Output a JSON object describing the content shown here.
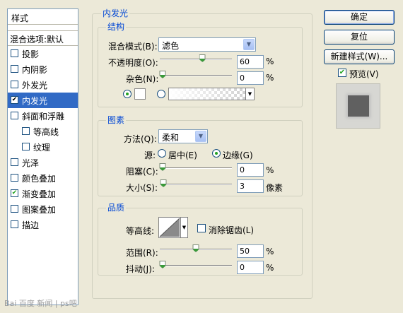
{
  "left_panel": {
    "header": "样式",
    "default_item": "混合选项:默认",
    "items": [
      {
        "label": "投影",
        "checked": false,
        "indent": false
      },
      {
        "label": "内阴影",
        "checked": false,
        "indent": false
      },
      {
        "label": "外发光",
        "checked": false,
        "indent": false
      },
      {
        "label": "内发光",
        "checked": true,
        "indent": false,
        "selected": true
      },
      {
        "label": "斜面和浮雕",
        "checked": false,
        "indent": false
      },
      {
        "label": "等高线",
        "checked": false,
        "indent": true
      },
      {
        "label": "纹理",
        "checked": false,
        "indent": true
      },
      {
        "label": "光泽",
        "checked": false,
        "indent": false
      },
      {
        "label": "颜色叠加",
        "checked": false,
        "indent": false
      },
      {
        "label": "渐变叠加",
        "checked": true,
        "indent": false
      },
      {
        "label": "图案叠加",
        "checked": false,
        "indent": false
      },
      {
        "label": "描边",
        "checked": false,
        "indent": false
      }
    ]
  },
  "panel_title": "内发光",
  "structure": {
    "title": "结构",
    "blend_mode_label": "混合模式(B):",
    "blend_mode_value": "滤色",
    "opacity_label": "不透明度(O):",
    "opacity_value": "60",
    "opacity_fraction": 0.6,
    "noise_label": "杂色(N):",
    "noise_value": "0",
    "noise_fraction": 0,
    "percent": "%"
  },
  "elements": {
    "title": "图素",
    "technique_label": "方法(Q):",
    "technique_value": "柔和",
    "source_label": "源:",
    "source_center": "居中(E)",
    "source_edge": "边缘(G)",
    "choke_label": "阻塞(C):",
    "choke_value": "0",
    "choke_fraction": 0,
    "size_label": "大小(S):",
    "size_value": "3",
    "size_fraction": 0.012,
    "percent": "%",
    "pixels": "像素"
  },
  "quality": {
    "title": "品质",
    "contour_label": "等高线:",
    "antialias_label": "消除锯齿(L)",
    "range_label": "范围(R):",
    "range_value": "50",
    "range_fraction": 0.5,
    "jitter_label": "抖动(J):",
    "jitter_value": "0",
    "jitter_fraction": 0,
    "percent": "%"
  },
  "buttons": {
    "ok": "确定",
    "reset": "复位",
    "new_style": "新建样式(W)...",
    "preview": "预览(V)",
    "preview_checked": true
  },
  "watermark": "Bai 百度 新闻 | ps吧",
  "colors": {
    "accent": "#316ac5",
    "group_title": "#0046d5",
    "dialog_bg": "#ece9d8",
    "slider_thumb": "#3a9a3a",
    "preview_fill": "#606060"
  }
}
